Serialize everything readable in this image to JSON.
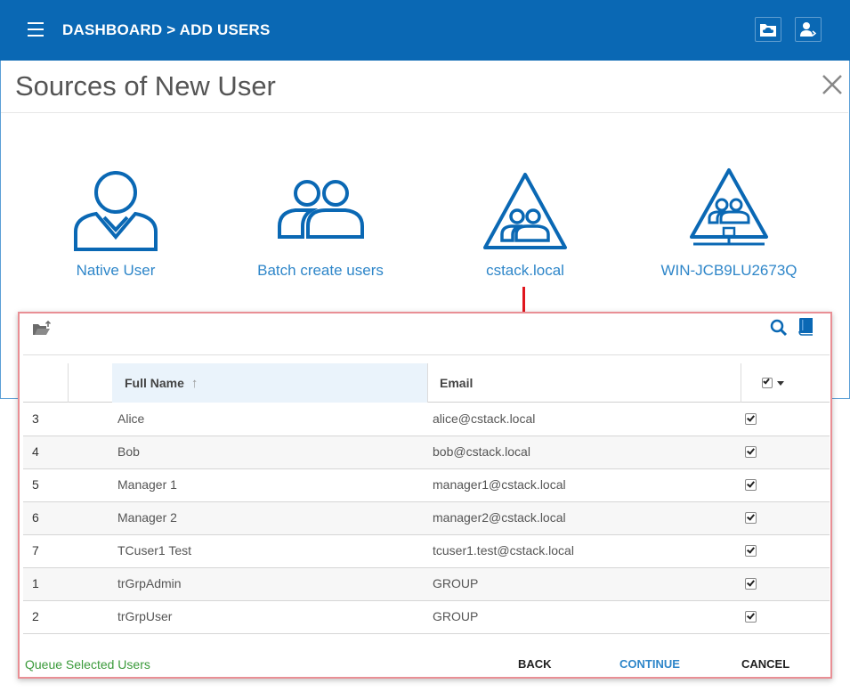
{
  "header": {
    "breadcrumb": "DASHBOARD > ADD USERS",
    "icons": [
      "menu-icon",
      "cloud-folder-icon",
      "user-switch-icon"
    ]
  },
  "dialog": {
    "title": "Sources of New User"
  },
  "sources": [
    {
      "label": "Native User",
      "icon": "user-icon"
    },
    {
      "label": "Batch create users",
      "icon": "users-icon"
    },
    {
      "label": "cstack.local",
      "icon": "domain-group-icon"
    },
    {
      "label": "WIN-JCB9LU2673Q",
      "icon": "network-domain-icon"
    }
  ],
  "table": {
    "columns": {
      "full_name": "Full Name",
      "email": "Email"
    },
    "rows": [
      {
        "index": "3",
        "name": "Alice",
        "email": "alice@cstack.local",
        "checked": true
      },
      {
        "index": "4",
        "name": "Bob",
        "email": "bob@cstack.local",
        "checked": true
      },
      {
        "index": "5",
        "name": "Manager 1",
        "email": "manager1@cstack.local",
        "checked": true
      },
      {
        "index": "6",
        "name": "Manager 2",
        "email": "manager2@cstack.local",
        "checked": true
      },
      {
        "index": "7",
        "name": "TCuser1 Test",
        "email": "tcuser1.test@cstack.local",
        "checked": true
      },
      {
        "index": "1",
        "name": "trGrpAdmin",
        "email": "GROUP",
        "checked": true
      },
      {
        "index": "2",
        "name": "trGrpUser",
        "email": "GROUP",
        "checked": true
      }
    ]
  },
  "footer": {
    "status": "Queue Selected Users",
    "back_label": "BACK",
    "continue_label": "CONTINUE",
    "cancel_label": "CANCEL"
  },
  "colors": {
    "brand": "#0a68b4",
    "link": "#2e86c9",
    "highlight_border": "#e98f95",
    "arrow": "#e0161d",
    "status": "#3a9a3a"
  }
}
